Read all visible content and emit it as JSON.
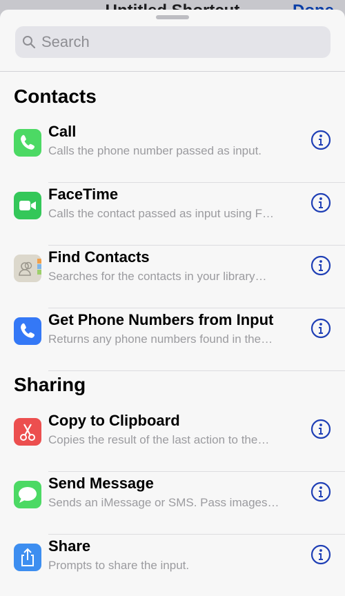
{
  "background_screen": {
    "title": "Untitled Shortcut",
    "done_label": "Done"
  },
  "search": {
    "placeholder": "Search"
  },
  "sections": [
    {
      "title": "Contacts"
    },
    {
      "title": "Sharing"
    }
  ],
  "actions": [
    {
      "title": "Call",
      "subtitle": "Calls the phone number passed as input.",
      "icon": "phone-icon",
      "color": "#4cd964"
    },
    {
      "title": "FaceTime",
      "subtitle": "Calls the contact passed as input using F…",
      "icon": "video-camera-icon",
      "color": "#34c759"
    },
    {
      "title": "Find Contacts",
      "subtitle": "Searches for the contacts in your library…",
      "icon": "contacts-book-icon",
      "color": "#dcd8cc"
    },
    {
      "title": "Get Phone Numbers from Input",
      "subtitle": "Returns any phone numbers found in the…",
      "icon": "phone-icon",
      "color": "#3478f6"
    },
    {
      "title": "Copy to Clipboard",
      "subtitle": "Copies the result of the last action to the…",
      "icon": "scissors-icon",
      "color": "#ec4f4f"
    },
    {
      "title": "Send Message",
      "subtitle": "Sends an iMessage or SMS. Pass images…",
      "icon": "message-bubble-icon",
      "color": "#4cd964"
    },
    {
      "title": "Share",
      "subtitle": "Prompts to share the input.",
      "icon": "share-icon",
      "color": "#3d8ef0"
    }
  ],
  "colors": {
    "info_accent": "#1f3fb5",
    "sheet_background": "#f7f7f7"
  }
}
